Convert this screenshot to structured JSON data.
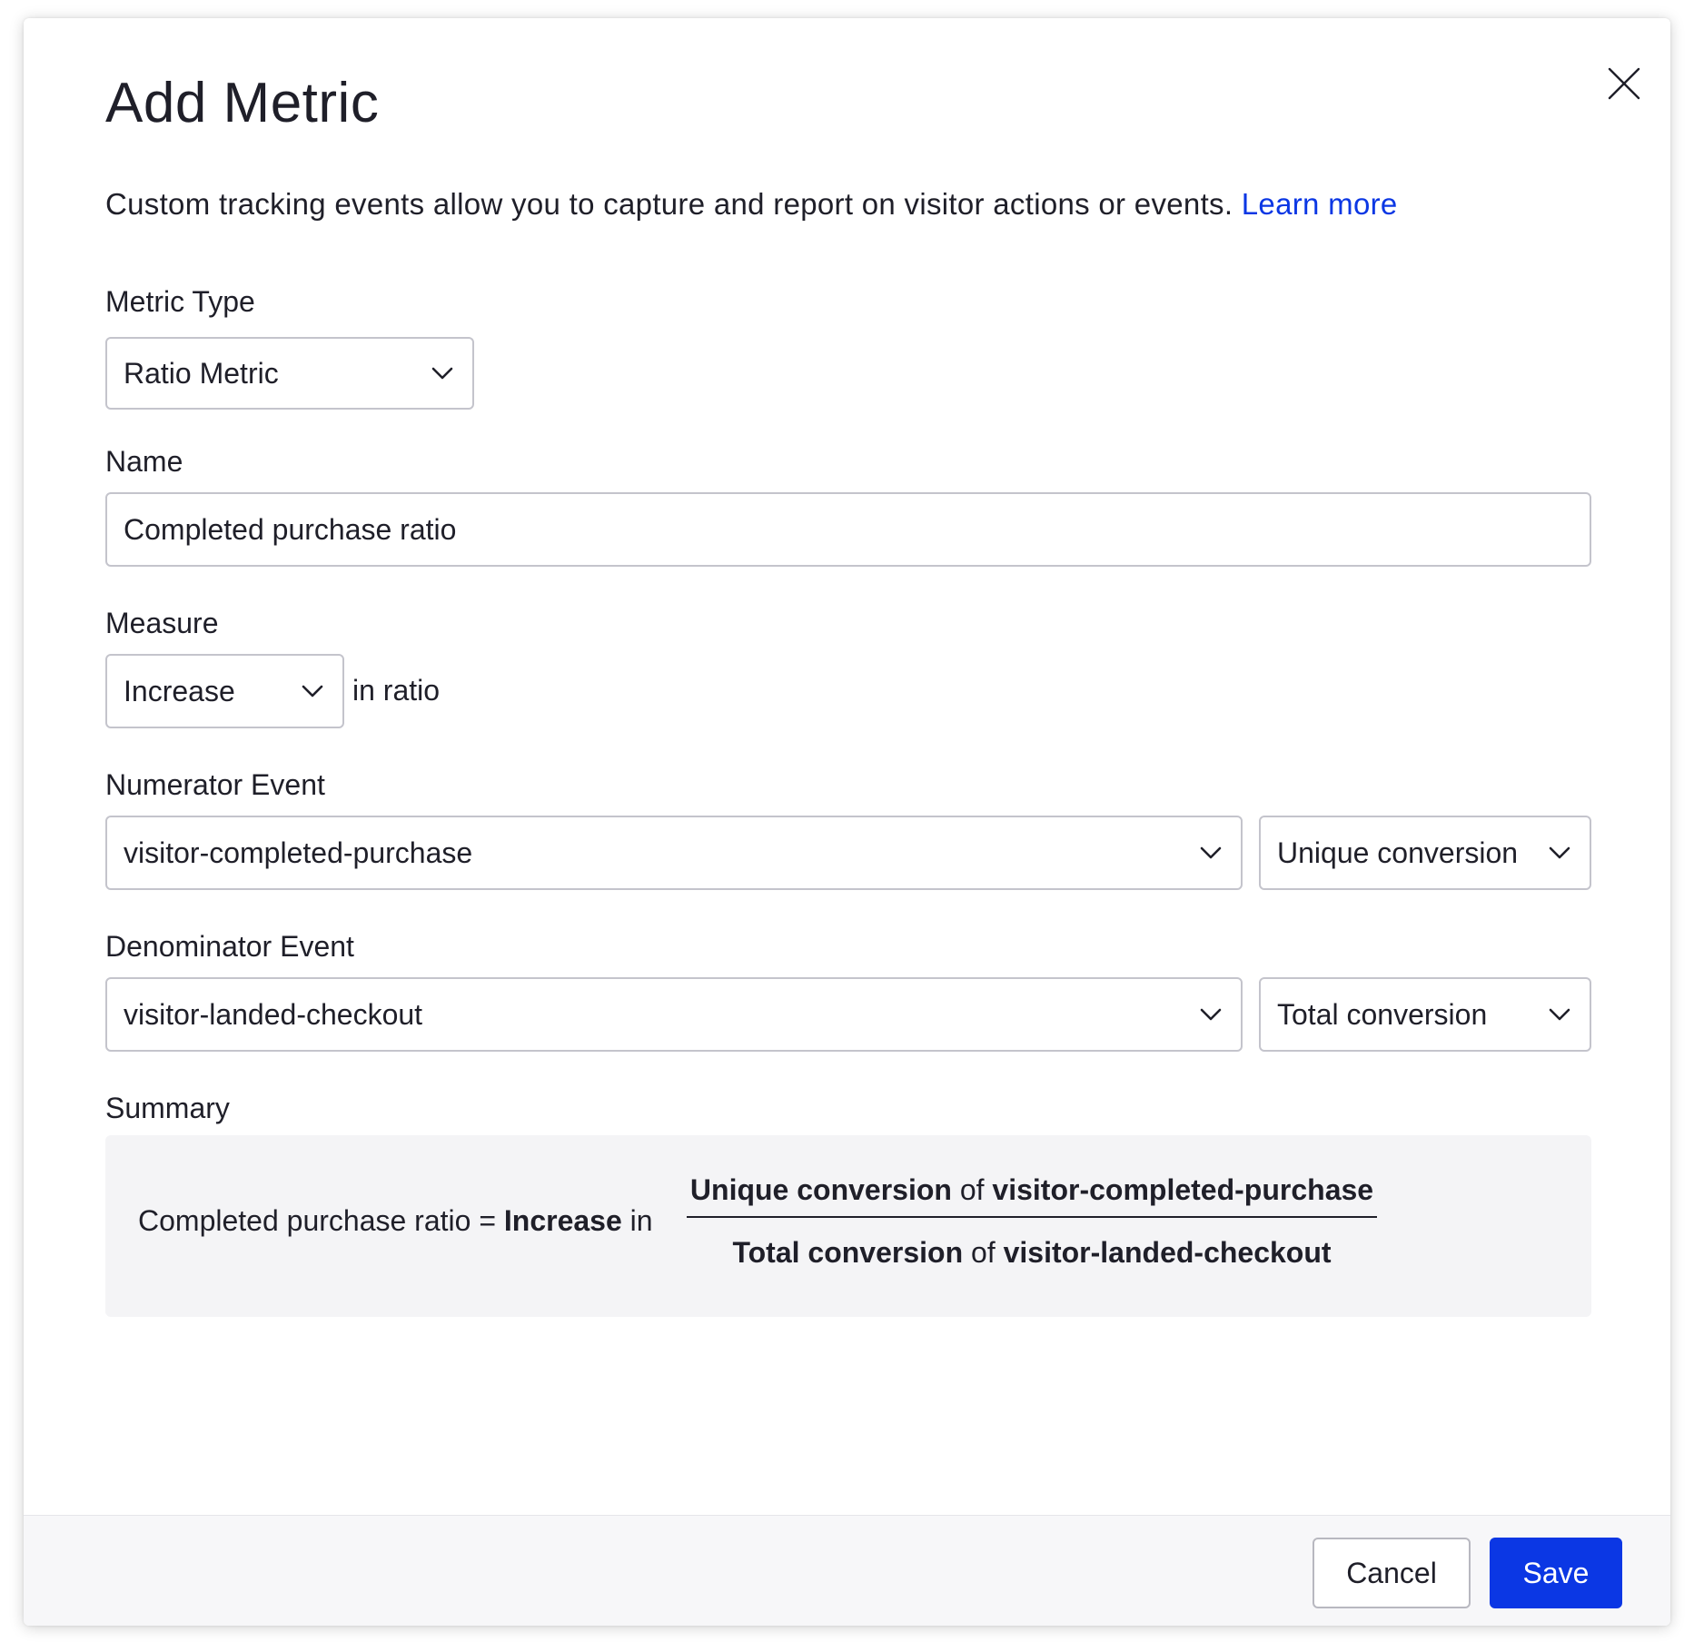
{
  "dialog": {
    "title": "Add Metric",
    "description": "Custom tracking events allow you to capture and report on visitor actions or events.",
    "learn_more": "Learn more",
    "close_icon": "close-icon"
  },
  "metric_type": {
    "label": "Metric Type",
    "value": "Ratio Metric"
  },
  "name": {
    "label": "Name",
    "value": "Completed purchase ratio"
  },
  "measure": {
    "label": "Measure",
    "value": "Increase",
    "suffix": "in ratio"
  },
  "numerator": {
    "label": "Numerator Event",
    "event": "visitor-completed-purchase",
    "aggregation": "Unique conversion"
  },
  "denominator": {
    "label": "Denominator Event",
    "event": "visitor-landed-checkout",
    "aggregation": "Total conversion"
  },
  "summary": {
    "label": "Summary",
    "name": "Completed purchase ratio",
    "equals": "=",
    "direction": "Increase",
    "in": "in",
    "of": "of",
    "numerator_aggregation": "Unique conversion",
    "numerator_event": "visitor-completed-purchase",
    "denominator_aggregation": "Total conversion",
    "denominator_event": "visitor-landed-checkout"
  },
  "footer": {
    "cancel_label": "Cancel",
    "save_label": "Save"
  },
  "colors": {
    "primary": "#0b37e4",
    "text": "#1f1f29",
    "summary_bg": "#f4f4f6",
    "border": "#c4c4cc"
  }
}
